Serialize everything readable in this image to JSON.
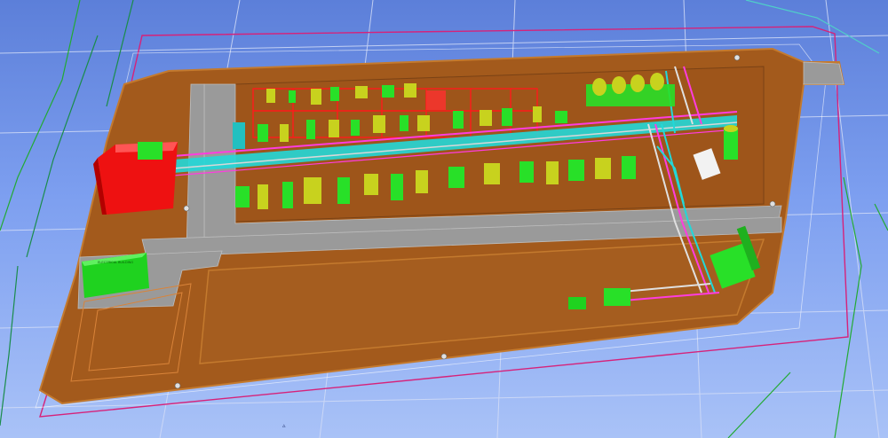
{
  "viewport": {
    "background_top": "#5c7fd9",
    "background_bottom": "#a9c2f7",
    "gridline_color": "#cfd9f5"
  },
  "model": {
    "pad_color": "#a35a1c",
    "pad_edge_color": "#c47a2e",
    "road_color": "#9a9a9a",
    "boundary_color": "#d6227a",
    "contour_color": "#22aa33",
    "equipment_green": "#28e028",
    "equipment_yellow": "#c8d21e",
    "pipe_rack_cyan": "#22d8d8",
    "pipe_magenta": "#ff3ce0",
    "steel_red": "#ff1a1a",
    "building_red": "#ee1111",
    "building_green": "#1fd21f",
    "substation_label": "ELECTRICAL BUILDING",
    "axis_marker": "▵"
  },
  "buildings": {
    "red_building": "main-building",
    "green_building": "electrical-building"
  }
}
